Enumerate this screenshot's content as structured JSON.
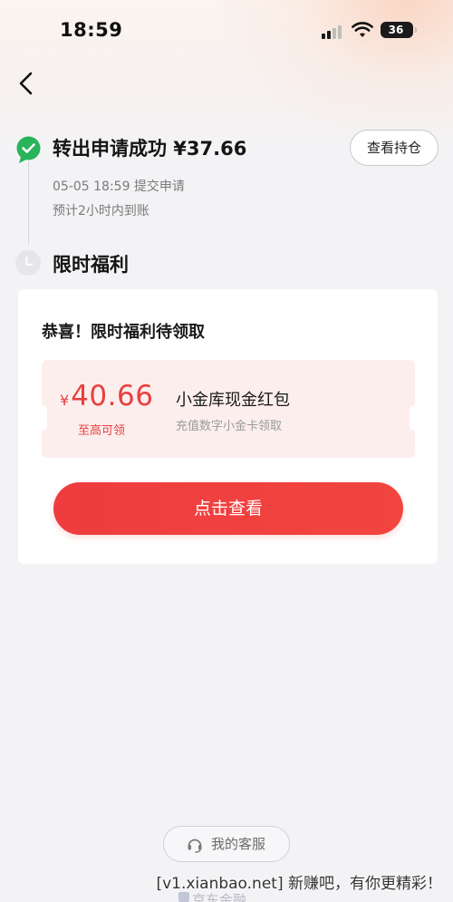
{
  "status_bar": {
    "time": "18:59",
    "battery_level": "36"
  },
  "step1": {
    "title": "转出申请成功 ¥37.66",
    "submit_time": "05-05 18:59 提交申请",
    "eta": "预计2小时内到账",
    "view_holdings_label": "查看持仓"
  },
  "step2": {
    "title": "限时福利"
  },
  "card": {
    "title": "恭喜！限时福利待领取",
    "coupon": {
      "currency": "¥",
      "amount": "40.66",
      "amount_note": "至高可领",
      "name": "小金库现金红包",
      "description": "充值数字小金卡领取"
    },
    "cta_label": "点击查看"
  },
  "footer": {
    "service_label": "我的客服",
    "brand": "京东金融"
  },
  "watermark": "[v1.xianbao.net] 新赚吧，有你更精彩！",
  "colors": {
    "accent_red": "#e8403f",
    "success_green": "#29b35a"
  },
  "icons": [
    "back-arrow-icon",
    "check-circle-icon",
    "clock-icon",
    "headset-icon",
    "signal-icon",
    "wifi-icon",
    "battery-icon"
  ]
}
